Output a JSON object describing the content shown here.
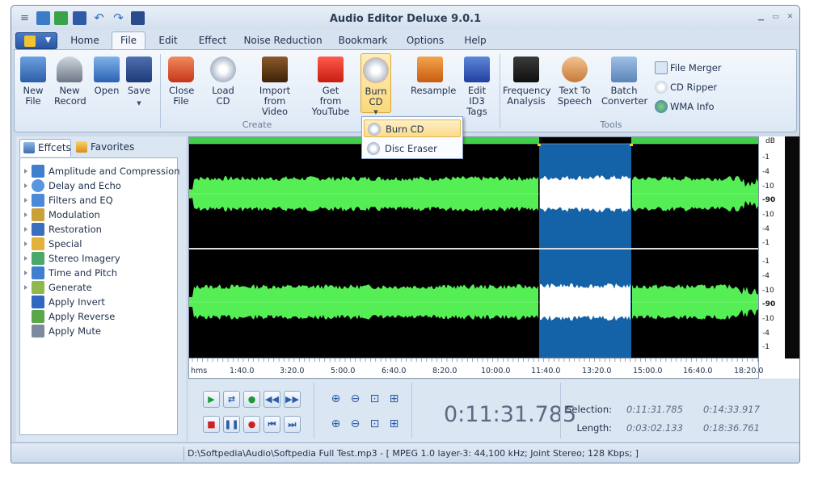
{
  "window": {
    "title": "Audio Editor Deluxe 9.0.1"
  },
  "tabs": [
    {
      "label": "Home"
    },
    {
      "label": "File"
    },
    {
      "label": "Edit"
    },
    {
      "label": "Effect"
    },
    {
      "label": "Noise Reduction"
    },
    {
      "label": "Bookmark"
    },
    {
      "label": "Options"
    },
    {
      "label": "Help"
    }
  ],
  "active_tab": "File",
  "ribbon": {
    "create": {
      "label": "Create",
      "buttons": [
        {
          "label": "New File",
          "icon": "new-file-icon"
        },
        {
          "label": "New Record",
          "icon": "microphone-icon"
        },
        {
          "label": "Open",
          "icon": "open-folder-icon"
        },
        {
          "label": "Save",
          "icon": "floppy-icon"
        },
        {
          "label": "Close File",
          "icon": "power-icon"
        },
        {
          "label": "Load CD",
          "icon": "cd-icon"
        },
        {
          "label": "Import from Video",
          "icon": "film-icon"
        },
        {
          "label": "Get from YouTube",
          "icon": "youtube-icon"
        },
        {
          "label": "Burn CD",
          "icon": "burn-cd-icon"
        },
        {
          "label": "Resample",
          "icon": "resample-icon"
        },
        {
          "label": "Edit ID3 Tags",
          "icon": "id3-tag-icon"
        }
      ]
    },
    "tools": {
      "label": "Tools",
      "buttons": [
        {
          "label": "Frequency Analysis",
          "icon": "frequency-chart-icon"
        },
        {
          "label": "Text To Speech",
          "icon": "speech-icon"
        },
        {
          "label": "Batch Converter",
          "icon": "grid-icon"
        }
      ],
      "small_items": [
        {
          "label": "File Merger",
          "icon": "file-merger-icon"
        },
        {
          "label": "CD Ripper",
          "icon": "cd-ripper-icon"
        },
        {
          "label": "WMA Info",
          "icon": "wma-info-icon"
        }
      ]
    }
  },
  "dropdown": {
    "items": [
      {
        "label": "Burn CD",
        "icon": "burn-cd-icon",
        "highlighted": true
      },
      {
        "label": "Disc Eraser",
        "icon": "disc-eraser-icon",
        "highlighted": false
      }
    ]
  },
  "left_panel": {
    "tabs": [
      {
        "label": "Effcets",
        "icon": "effects-icon"
      },
      {
        "label": "Favorites",
        "icon": "favorites-icon"
      }
    ],
    "tree": [
      {
        "label": "Amplitude and Compression",
        "expandable": true
      },
      {
        "label": "Delay and Echo",
        "expandable": true
      },
      {
        "label": "Filters and EQ",
        "expandable": true
      },
      {
        "label": "Modulation",
        "expandable": true
      },
      {
        "label": "Restoration",
        "expandable": true
      },
      {
        "label": "Special",
        "expandable": true
      },
      {
        "label": "Stereo Imagery",
        "expandable": true
      },
      {
        "label": "Time and Pitch",
        "expandable": true
      },
      {
        "label": "Generate",
        "expandable": true
      },
      {
        "label": "Apply Invert",
        "expandable": false
      },
      {
        "label": "Apply Reverse",
        "expandable": false
      },
      {
        "label": "Apply Mute",
        "expandable": false
      }
    ]
  },
  "waveform": {
    "db_unit": "dB",
    "db_labels_top": [
      "-1",
      "-4",
      "-10",
      "-90",
      "-10",
      "-4",
      "-1"
    ],
    "db_labels_bottom": [
      "-1",
      "-4",
      "-10",
      "-90",
      "-10",
      "-4",
      "-1"
    ],
    "timeline": [
      "hms",
      "1:40.0",
      "3:20.0",
      "5:00.0",
      "6:40.0",
      "8:20.0",
      "10:00.0",
      "11:40.0",
      "13:20.0",
      "15:00.0",
      "16:40.0",
      "18:20.0"
    ],
    "colors": {
      "wave": "#55ee55",
      "selection": "#1463a8",
      "selected_wave": "#ffffff",
      "background": "#000000"
    }
  },
  "transport": {
    "current_time": "0:11:31.785",
    "selection_label": "Selection:",
    "length_label": "Length:",
    "selection_start": "0:11:31.785",
    "selection_end": "0:14:33.917",
    "selection_length": "0:03:02.133",
    "total_length": "0:18:36.761"
  },
  "status": {
    "text": "D:\\Softpedia\\Audio\\Softpedia Full Test.mp3 - [ MPEG 1.0 layer-3: 44,100 kHz; Joint Stereo; 128 Kbps;  ]"
  }
}
